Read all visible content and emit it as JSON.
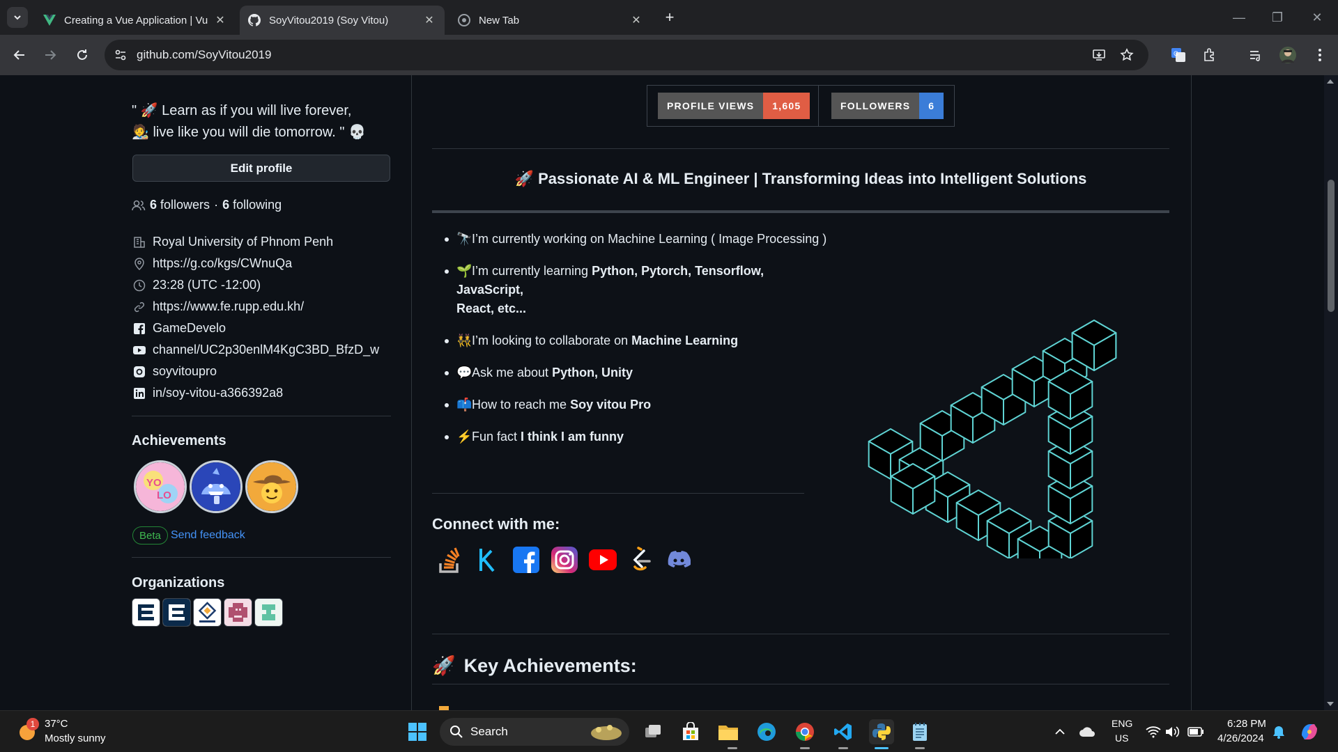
{
  "browser": {
    "tabs": [
      {
        "title": "Creating a Vue Application | Vu",
        "icon": "vue-icon",
        "active": false
      },
      {
        "title": "SoyVitou2019 (Soy Vitou)",
        "icon": "github-icon",
        "active": true
      },
      {
        "title": "New Tab",
        "icon": "chrome-icon",
        "active": false
      }
    ],
    "url": "github.com/SoyVitou2019"
  },
  "sidebar": {
    "quote_line1": "\" 🚀 Learn as if you will live forever,",
    "quote_line2": "🧑‍🎨 live like you will die tomorrow. \" 💀",
    "edit_profile": "Edit profile",
    "followers_count": "6",
    "followers_label": "followers",
    "separator": "·",
    "following_count": "6",
    "following_label": "following",
    "details": [
      {
        "icon": "organization-icon",
        "text": "Royal University of Phnom Penh"
      },
      {
        "icon": "location-icon",
        "text": "https://g.co/kgs/CWnuQa"
      },
      {
        "icon": "clock-icon",
        "text": "23:28 (UTC -12:00)"
      },
      {
        "icon": "link-icon",
        "text": "https://www.fe.rupp.edu.kh/"
      },
      {
        "icon": "facebook-icon",
        "text": "GameDevelo"
      },
      {
        "icon": "youtube-icon",
        "text": "channel/UC2p30enlM4KgC3BD_BfzD_w"
      },
      {
        "icon": "instagram-icon",
        "text": "soyvitoupro"
      },
      {
        "icon": "linkedin-icon",
        "text": "in/soy-vitou-a366392a8"
      }
    ],
    "achievements_title": "Achievements",
    "badges": [
      {
        "name": "yolo-badge",
        "color": "#f7a8d8"
      },
      {
        "name": "shark-badge",
        "color": "#3d5fd9"
      },
      {
        "name": "quickdraw-badge",
        "color": "#f2a93b"
      }
    ],
    "beta_label": "Beta",
    "feedback_label": "Send feedback",
    "organizations_title": "Organizations"
  },
  "readme": {
    "profile_views_label": "PROFILE VIEWS",
    "profile_views_value": "1,605",
    "followers_label": "FOLLOWERS",
    "followers_value": "6",
    "headline": "🚀 Passionate AI & ML Engineer | Transforming Ideas into Intelligent Solutions",
    "bullets": [
      {
        "emoji": "🔭",
        "text": "I’m currently working on Machine Learning ( Image Processing )",
        "bold": ""
      },
      {
        "emoji": "🌱",
        "text": "I’m currently learning ",
        "bold": "Python, Pytorch, Tensorflow, JavaScript,",
        "line2": "React, etc..."
      },
      {
        "emoji": "👯",
        "text": "I’m looking to collaborate on ",
        "bold": "Machine Learning"
      },
      {
        "emoji": "💬",
        "text": "Ask me about ",
        "bold": "Python, Unity"
      },
      {
        "emoji": "📫",
        "text": "How to reach me ",
        "bold": "Soy vitou Pro"
      },
      {
        "emoji": "⚡",
        "text": "Fun fact ",
        "bold": "I think I am funny"
      }
    ],
    "connect_title": "Connect with me:",
    "key_achievements": "Key Achievements:",
    "key_emoji": "🚀"
  },
  "taskbar": {
    "weather_temp": "37°C",
    "weather_desc": "Mostly sunny",
    "weather_badge": "1",
    "search": "Search",
    "lang1": "ENG",
    "lang2": "US",
    "time": "6:28 PM",
    "date": "4/26/2024"
  },
  "colors": {
    "views_value_bg": "#e05d44",
    "followers_value_bg": "#3b7dd8",
    "cube_stroke": "#5fd3d3"
  }
}
